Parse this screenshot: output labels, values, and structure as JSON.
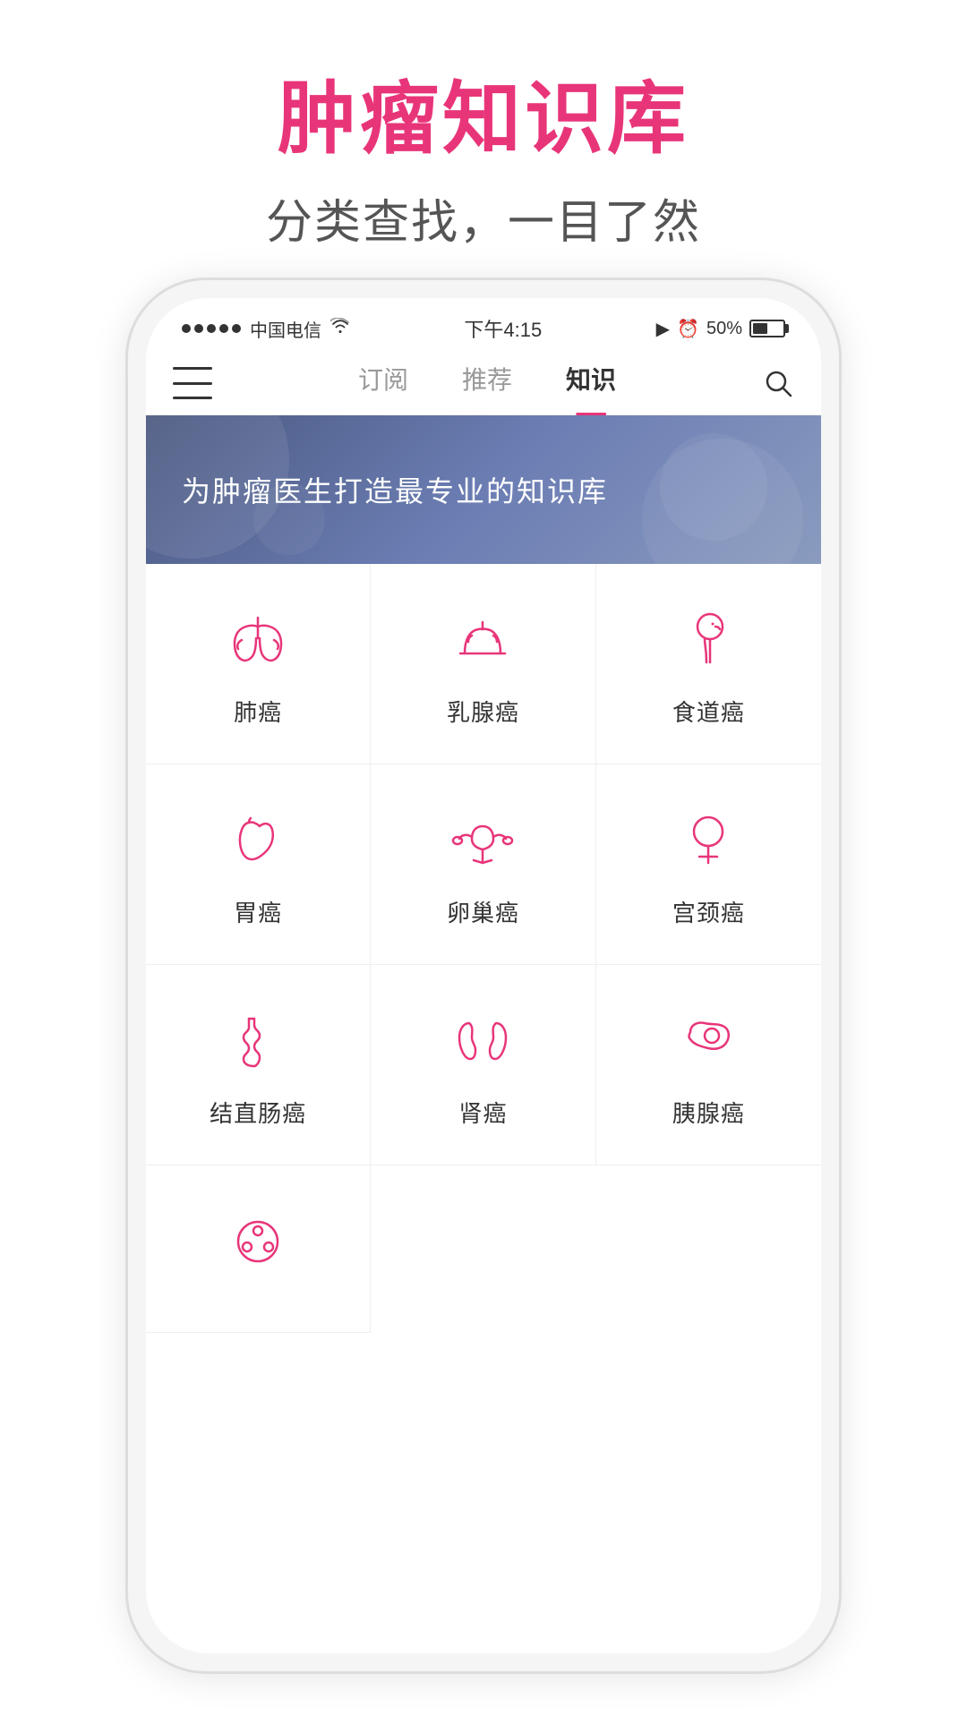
{
  "page": {
    "title_main": "肿瘤知识库",
    "title_sub": "分类查找，一目了然"
  },
  "status_bar": {
    "dots": 5,
    "carrier": "中国电信",
    "wifi": "WiFi",
    "time": "下午4:15",
    "arrow": "➤",
    "clock": "⏰",
    "battery_pct": "50%"
  },
  "nav": {
    "tab1": "订阅",
    "tab2": "推荐",
    "tab3": "知识"
  },
  "banner": {
    "text": "为肿瘤医生打造最专业的知识库"
  },
  "cancer_items": [
    {
      "id": "lung",
      "label": "肺癌",
      "icon": "lung"
    },
    {
      "id": "breast",
      "label": "乳腺癌",
      "icon": "breast"
    },
    {
      "id": "esophag",
      "label": "食道癌",
      "icon": "esophagus"
    },
    {
      "id": "stomach",
      "label": "胃癌",
      "icon": "stomach"
    },
    {
      "id": "ovary",
      "label": "卵巢癌",
      "icon": "ovary"
    },
    {
      "id": "cervix",
      "label": "宫颈癌",
      "icon": "cervix"
    },
    {
      "id": "colon",
      "label": "结直肠癌",
      "icon": "colon"
    },
    {
      "id": "kidney",
      "label": "肾癌",
      "icon": "kidney"
    },
    {
      "id": "pancreas",
      "label": "胰腺癌",
      "icon": "pancreas"
    },
    {
      "id": "liver",
      "label": "",
      "icon": "liver"
    }
  ]
}
